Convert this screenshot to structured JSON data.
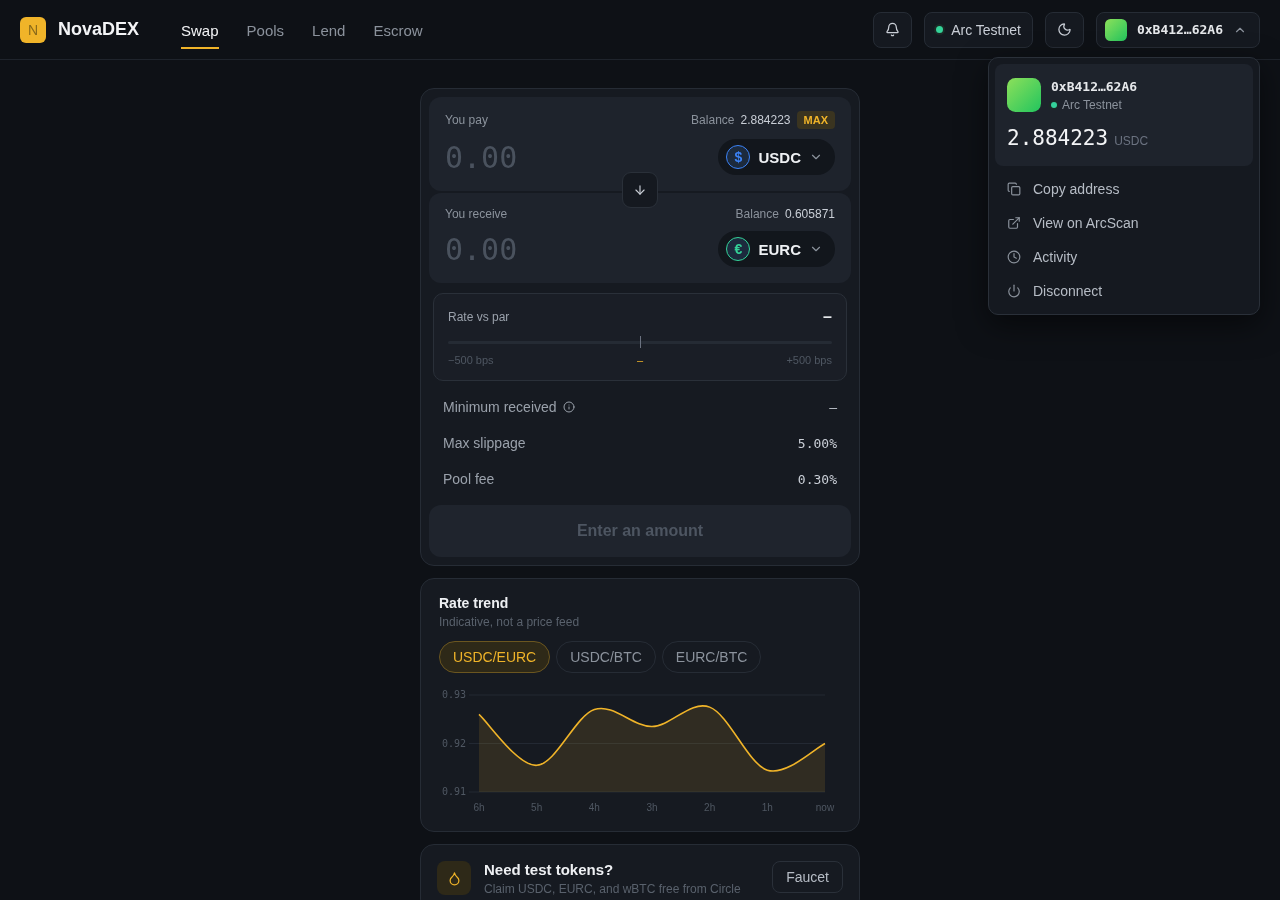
{
  "header": {
    "logo_letter": "N",
    "brand": "NovaDEX",
    "nav": [
      {
        "label": "Swap",
        "selected": true
      },
      {
        "label": "Pools",
        "selected": false
      },
      {
        "label": "Lend",
        "selected": false
      },
      {
        "label": "Escrow",
        "selected": false
      }
    ],
    "network": {
      "label": "Arc Testnet",
      "color": "#34d399"
    },
    "wallet": {
      "address": "0xB412…62A6",
      "expanded": true
    }
  },
  "wallet_menu": {
    "address": "0xB412…62A6",
    "network": {
      "label": "Arc Testnet",
      "color": "#34d399"
    },
    "balance": "2.884223",
    "unit": "USDC",
    "items": [
      {
        "kind": "copy",
        "label": "Copy address"
      },
      {
        "kind": "external",
        "label": "View on ArcScan"
      },
      {
        "kind": "clock",
        "label": "Activity"
      },
      {
        "kind": "power",
        "label": "Disconnect"
      }
    ]
  },
  "swap": {
    "pay": {
      "label": "You pay",
      "balance_label": "Balance",
      "balance": "2.884223",
      "max": "MAX",
      "placeholder": "0.00",
      "token": {
        "symbol": "USDC",
        "glyph": "$",
        "color": "#3b82f6"
      }
    },
    "receive": {
      "label": "You receive",
      "balance_label": "Balance",
      "balance": "0.605871",
      "placeholder": "0.00",
      "token": {
        "symbol": "EURC",
        "glyph": "€",
        "color": "#34d399"
      }
    },
    "rate": {
      "label": "Rate vs par",
      "value": "–",
      "level": 0.5,
      "min_label": "−500 bps",
      "mid_label": "–",
      "max_label": "+500 bps"
    },
    "details": [
      {
        "label": "Minimum received",
        "info": true,
        "value": "–"
      },
      {
        "label": "Max slippage",
        "info": false,
        "value": "5.00%"
      },
      {
        "label": "Pool fee",
        "info": false,
        "value": "0.30%"
      }
    ],
    "submit": {
      "label": "Enter an amount",
      "disabled": true
    }
  },
  "trend": {
    "title": "Rate trend",
    "subtitle": "Indicative, not a price feed",
    "pairs": [
      {
        "label": "USDC/EURC",
        "selected": true
      },
      {
        "label": "USDC/BTC",
        "selected": false
      },
      {
        "label": "EURC/BTC",
        "selected": false
      }
    ],
    "chart_data": {
      "type": "area",
      "categories": [
        "6h",
        "5h",
        "4h",
        "3h",
        "2h",
        "1h",
        "now"
      ],
      "series": [
        {
          "color": "#f0b429",
          "values": [
            0.926,
            0.9155,
            0.927,
            0.9235,
            0.9275,
            0.9145,
            0.92
          ]
        }
      ],
      "ylim": [
        0.91,
        0.93
      ],
      "yticks": [
        {
          "value": 0.93,
          "label": "0.93"
        },
        {
          "value": 0.92,
          "label": "0.92"
        },
        {
          "value": 0.91,
          "label": "0.91"
        }
      ]
    }
  },
  "faucet": {
    "title": "Need test tokens?",
    "text": "Claim USDC, EURC, and wBTC free from Circle",
    "button": "Faucet"
  }
}
